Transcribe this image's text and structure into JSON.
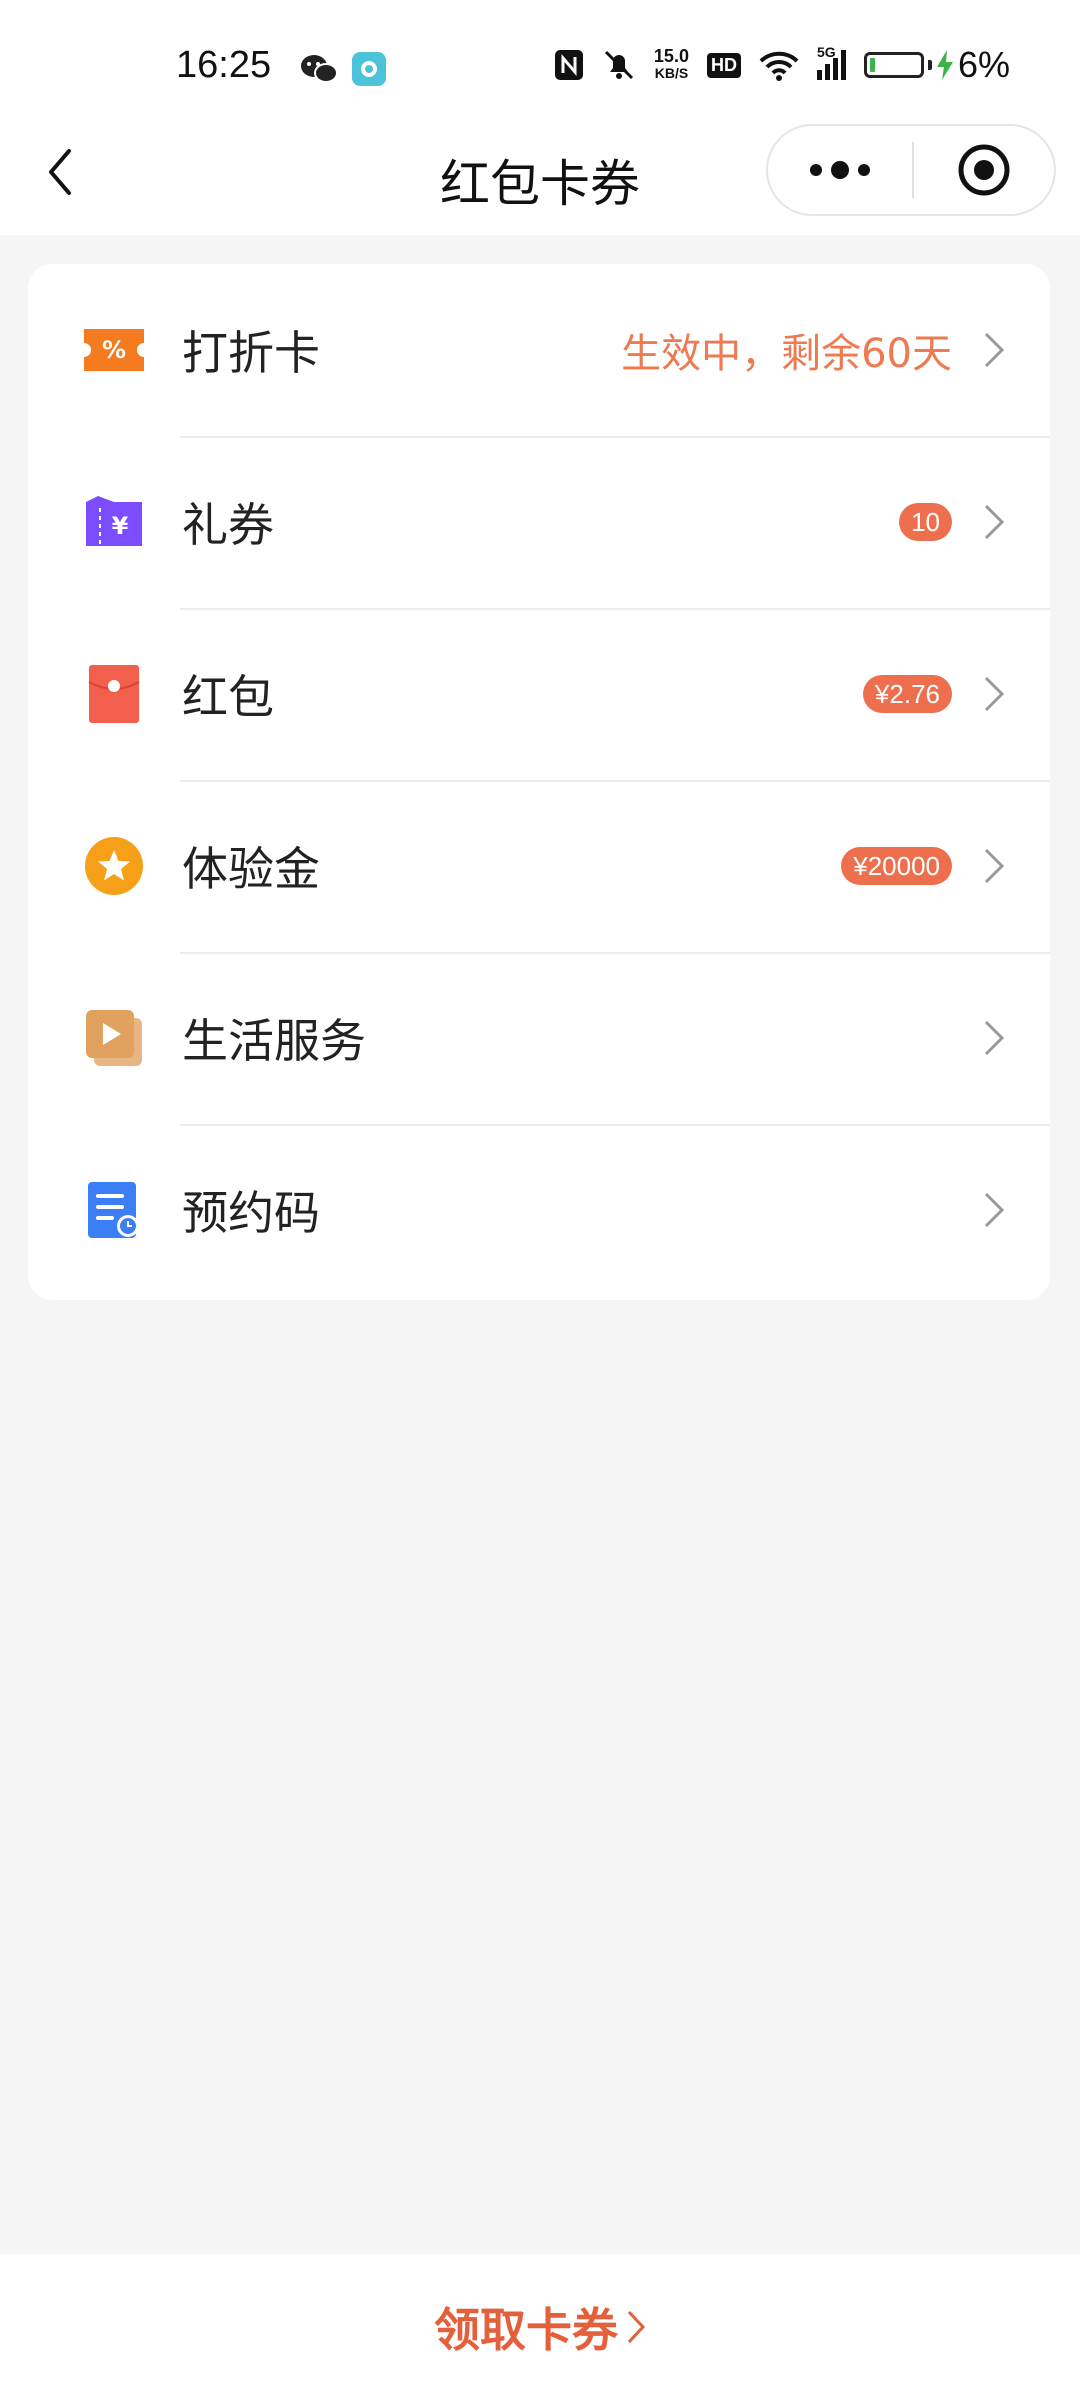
{
  "status_bar": {
    "time": "16:25",
    "net_speed_value": "15.0",
    "net_speed_unit": "KB/S",
    "hd_label": "HD",
    "signal_label": "5G",
    "battery_percent": "6%",
    "battery_level": 0.06,
    "icons": [
      "wechat-icon",
      "camera-app-icon",
      "nfc-icon",
      "mute-bell-icon",
      "wifi-icon",
      "signal-icon",
      "charging-icon"
    ]
  },
  "nav": {
    "title": "红包卡券",
    "back_icon": "back-chevron-icon",
    "more_icon": "more-dots-icon",
    "close_icon": "target-close-icon"
  },
  "items": [
    {
      "label": "打折卡",
      "status": "生效中，剩余60天",
      "badge": "",
      "icon": "discount-ticket-icon",
      "color": "#f47b20"
    },
    {
      "label": "礼券",
      "status": "",
      "badge": "10",
      "icon": "gift-voucher-icon",
      "color": "#7b4dff"
    },
    {
      "label": "红包",
      "status": "",
      "badge": "¥2.76",
      "icon": "red-packet-icon",
      "color": "#f25f4c"
    },
    {
      "label": "体验金",
      "status": "",
      "badge": "¥20000",
      "icon": "star-coin-icon",
      "color": "#f6a019"
    },
    {
      "label": "生活服务",
      "status": "",
      "badge": "",
      "icon": "play-card-icon",
      "color": "#e0a25e"
    },
    {
      "label": "预约码",
      "status": "",
      "badge": "",
      "icon": "booking-doc-icon",
      "color": "#3c7ef3"
    }
  ],
  "footer": {
    "claim_label": "领取卡券"
  },
  "colors": {
    "accent": "#e4603b",
    "badge": "#ee6f4e",
    "background": "#f5f5f5"
  }
}
